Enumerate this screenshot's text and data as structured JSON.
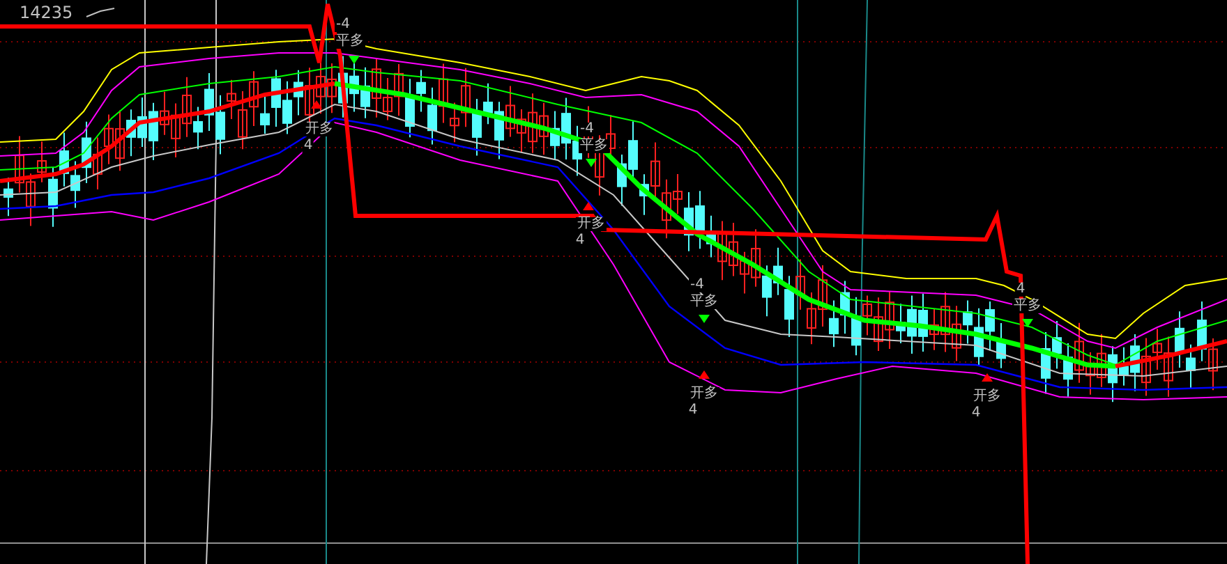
{
  "price_label": "14235",
  "signals": [
    {
      "exit_count": "-4",
      "exit_text": "平多",
      "entry_text": "开多",
      "entry_count": "4"
    },
    {
      "exit_count": "-4",
      "exit_text": "平多",
      "entry_text": "开多",
      "entry_count": "4"
    },
    {
      "exit_count": "-4",
      "exit_text": "平多",
      "entry_text": "开多",
      "entry_count": "4"
    },
    {
      "exit_count": "4",
      "exit_text": "平多",
      "entry_text": "开多",
      "entry_count": "4"
    }
  ]
}
